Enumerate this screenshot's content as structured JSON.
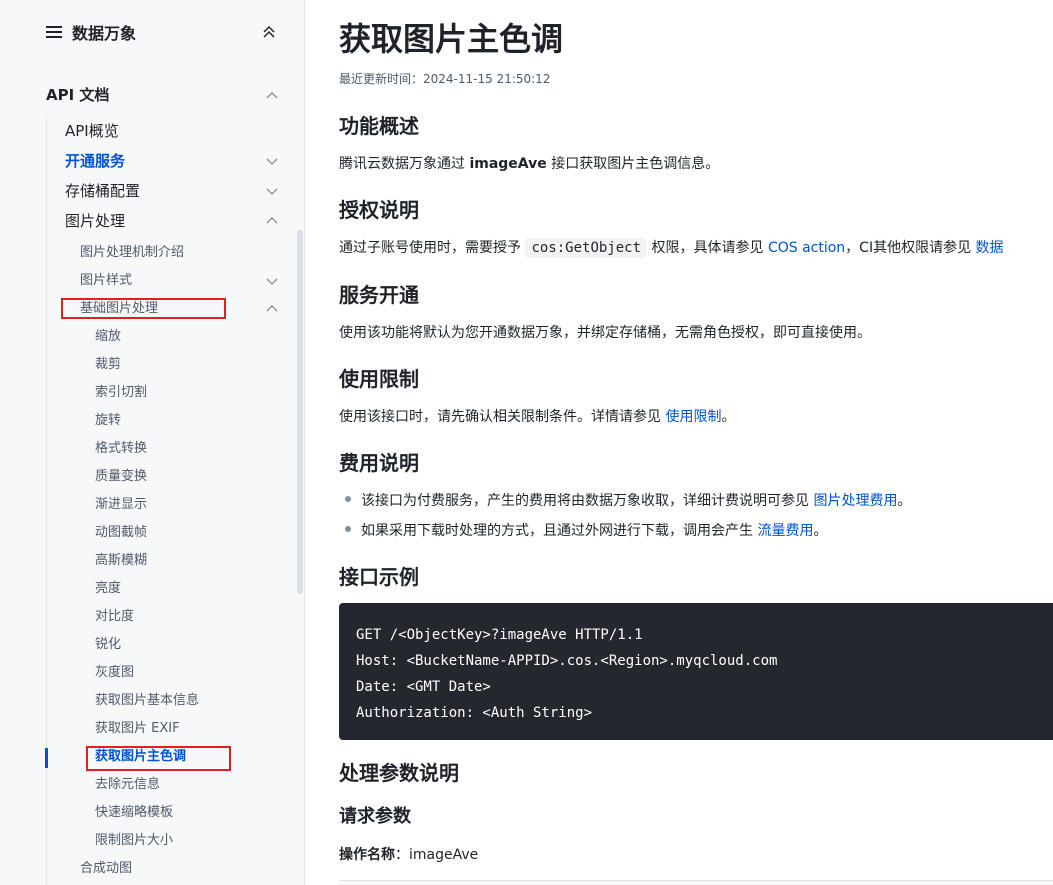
{
  "sidebar": {
    "title": "数据万象",
    "section": "API 文档",
    "items_l1": [
      {
        "label": "API概览",
        "active": false
      },
      {
        "label": "开通服务",
        "active": true
      },
      {
        "label": "存储桶配置",
        "active": false
      },
      {
        "label": "图片处理",
        "active": false
      }
    ],
    "items_l2": [
      {
        "label": "图片处理机制介绍"
      },
      {
        "label": "图片样式"
      },
      {
        "label": "基础图片处理"
      }
    ],
    "items_l3": [
      {
        "label": "缩放"
      },
      {
        "label": "裁剪"
      },
      {
        "label": "索引切割"
      },
      {
        "label": "旋转"
      },
      {
        "label": "格式转换"
      },
      {
        "label": "质量变换"
      },
      {
        "label": "渐进显示"
      },
      {
        "label": "动图截帧"
      },
      {
        "label": "高斯模糊"
      },
      {
        "label": "亮度"
      },
      {
        "label": "对比度"
      },
      {
        "label": "锐化"
      },
      {
        "label": "灰度图"
      },
      {
        "label": "获取图片基本信息"
      },
      {
        "label": "获取图片 EXIF"
      },
      {
        "label": "获取图片主色调"
      },
      {
        "label": "去除元信息"
      },
      {
        "label": "快速缩略模板"
      },
      {
        "label": "限制图片大小"
      }
    ],
    "last_l2": "合成动图"
  },
  "content": {
    "title": "获取图片主色调",
    "updated": "最近更新时间：2024-11-15 21:50:12",
    "s1": {
      "heading": "功能概述",
      "pre": "腾讯云数据万象通过 ",
      "bold": "imageAve",
      "post": " 接口获取图片主色调信息。"
    },
    "s2": {
      "heading": "授权说明",
      "pre": "通过子账号使用时，需要授予 ",
      "code": "cos:GetObject",
      "mid": " 权限，具体请参见 ",
      "link1": "COS action",
      "mid2": "，CI其他权限请参见 ",
      "link2": "数据"
    },
    "s3": {
      "heading": "服务开通",
      "text": "使用该功能将默认为您开通数据万象，并绑定存储桶，无需角色授权，即可直接使用。"
    },
    "s4": {
      "heading": "使用限制",
      "pre": "使用该接口时，请先确认相关限制条件。详情请参见 ",
      "link": "使用限制",
      "post": "。"
    },
    "s5": {
      "heading": "费用说明",
      "b1_pre": "该接口为付费服务，产生的费用将由数据万象收取，详细计费说明可参见 ",
      "b1_link": "图片处理费用",
      "b1_post": "。",
      "b2_pre": "如果采用下载时处理的方式，且通过外网进行下载，调用会产生 ",
      "b2_link": "流量费用",
      "b2_post": "。"
    },
    "s6": {
      "heading": "接口示例",
      "code": [
        "GET /<ObjectKey>?imageAve HTTP/1.1",
        "Host: <BucketName-APPID>.cos.<Region>.myqcloud.com",
        "Date: <GMT Date>",
        "Authorization: <Auth String>"
      ]
    },
    "s7": {
      "heading": "处理参数说明"
    },
    "s8": {
      "heading": "请求参数",
      "label": "操作名称",
      "value": "：imageAve"
    }
  },
  "colors": {
    "accent": "#0052d9",
    "highlight_box": "#e02020",
    "code_bg": "#24272e"
  }
}
